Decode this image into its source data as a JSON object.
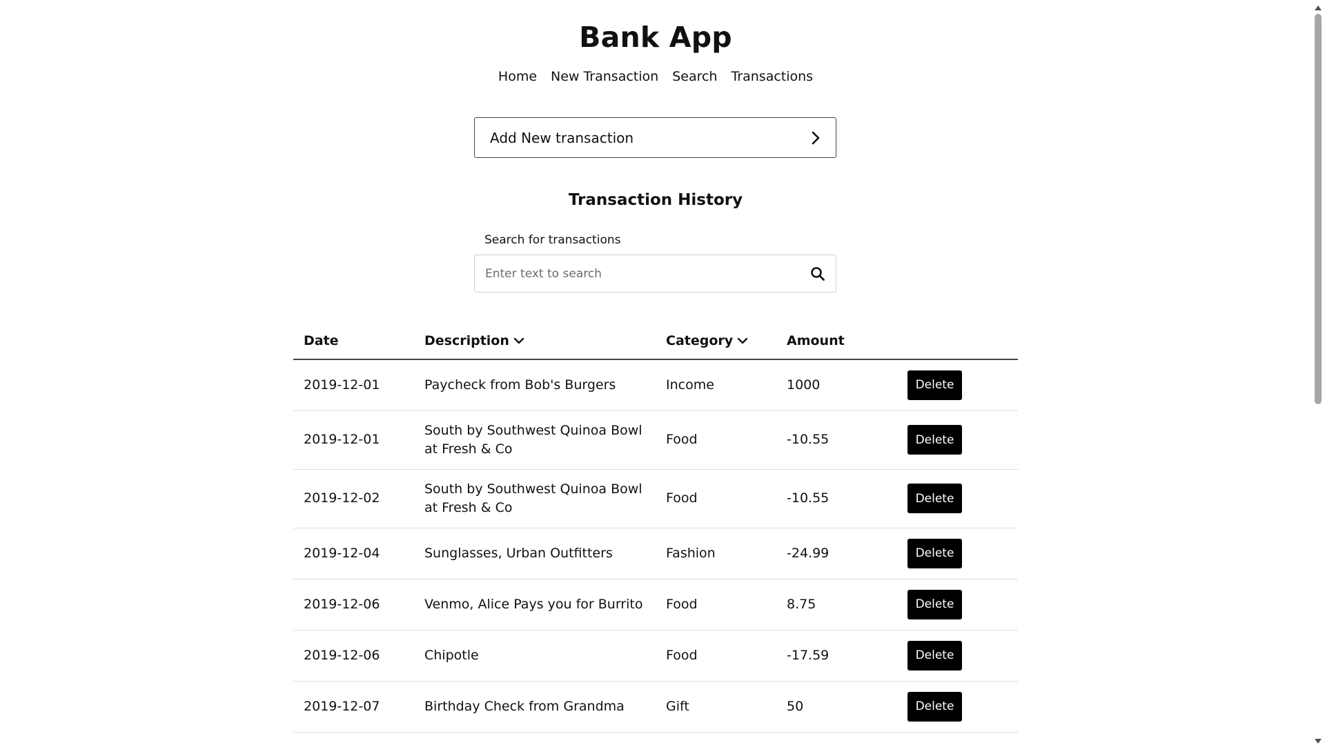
{
  "app": {
    "title": "Bank App"
  },
  "nav": {
    "items": [
      {
        "label": "Home"
      },
      {
        "label": "New Transaction"
      },
      {
        "label": "Search"
      },
      {
        "label": "Transactions"
      }
    ]
  },
  "add_transaction": {
    "label": "Add New transaction",
    "icon": "chevron-right-icon"
  },
  "history": {
    "title": "Transaction History"
  },
  "search": {
    "label": "Search for transactions",
    "placeholder": "Enter text to search",
    "value": "",
    "icon": "search-icon"
  },
  "table": {
    "columns": [
      {
        "label": "Date",
        "sortable": false
      },
      {
        "label": "Description",
        "sortable": true
      },
      {
        "label": "Category",
        "sortable": true
      },
      {
        "label": "Amount",
        "sortable": false
      },
      {
        "label": "",
        "sortable": false
      }
    ],
    "delete_label": "Delete",
    "rows": [
      {
        "date": "2019-12-01",
        "description": "Paycheck from Bob's Burgers",
        "category": "Income",
        "amount": "1000"
      },
      {
        "date": "2019-12-01",
        "description": "South by Southwest Quinoa Bowl at Fresh & Co",
        "category": "Food",
        "amount": "-10.55"
      },
      {
        "date": "2019-12-02",
        "description": "South by Southwest Quinoa Bowl at Fresh & Co",
        "category": "Food",
        "amount": "-10.55"
      },
      {
        "date": "2019-12-04",
        "description": "Sunglasses, Urban Outfitters",
        "category": "Fashion",
        "amount": "-24.99"
      },
      {
        "date": "2019-12-06",
        "description": "Venmo, Alice Pays you for Burrito",
        "category": "Food",
        "amount": "8.75"
      },
      {
        "date": "2019-12-06",
        "description": "Chipotle",
        "category": "Food",
        "amount": "-17.59"
      },
      {
        "date": "2019-12-07",
        "description": "Birthday Check from Grandma",
        "category": "Gift",
        "amount": "50"
      }
    ]
  },
  "colors": {
    "text": "#111111",
    "button_bg": "#000000",
    "button_text": "#ffffff",
    "border": "#444444",
    "row_divider": "#dedede",
    "scroll_thumb": "#a6a6a6"
  }
}
